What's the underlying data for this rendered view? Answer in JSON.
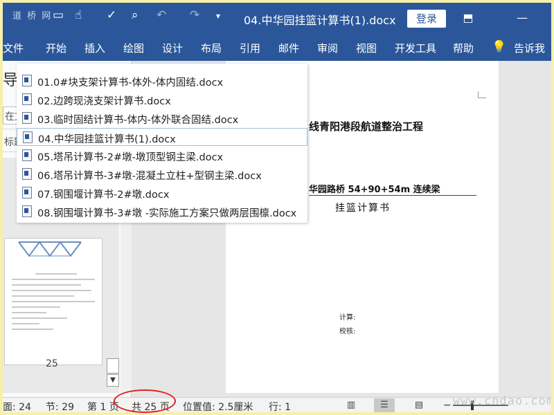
{
  "titlebar": {
    "qat_icons": [
      "save-icon",
      "touch-mode-icon",
      "spelling-icon",
      "print-preview-icon",
      "undo-icon",
      "redo-icon",
      "customize-icon"
    ],
    "doc_title": "04.中华园挂篮计算书(1).docx",
    "login_label": "登录",
    "ribbon_display_icon": "ribbon-display-icon",
    "minimize_label": "—"
  },
  "tabs": [
    "文件",
    "开始",
    "插入",
    "绘图",
    "设计",
    "布局",
    "引用",
    "邮件",
    "审阅",
    "视图",
    "开发工具",
    "帮助",
    "告诉我"
  ],
  "navpane": {
    "heading_partial": "导",
    "search_partial": "在文",
    "tab_partial": "标题",
    "thumbnail_page": "25"
  },
  "recent_files": [
    "01.0#块支架计算书-体外-体内固结.docx",
    "02.边跨现浇支架计算书.docx",
    "03.临时固结计算书-体内-体外联合固结.docx",
    "04.中华园挂篮计算书(1).docx",
    "05.塔吊计算书-2#墩-墩顶型钢主梁.docx",
    "06.塔吊计算书-3#墩-混凝土立柱+型钢主梁.docx",
    "07.钢围堰计算书-2#墩.docx",
    "08.钢围堰计算书-3#墩 -实际施工方案只做两层围檩.docx"
  ],
  "active_recent_index": 3,
  "document": {
    "heading": "线青阳港段航道整治工程",
    "bridge": "华园路桥 54+90+54m 连续梁",
    "calc_title": "挂篮计算书",
    "calc_label": "计算:",
    "check_label": "校核:"
  },
  "statusbar": {
    "page_num": "面: 24",
    "section": "节: 29",
    "page_of": "第 1 页",
    "total": "共 25 页",
    "position": "位置值: 2.5厘米",
    "line": "行: 1",
    "views": [
      "read-mode-icon",
      "print-layout-icon",
      "web-layout-icon"
    ]
  },
  "watermarks": {
    "top_left": "道 桥 网",
    "bottom_right": "www.cndao.com"
  }
}
